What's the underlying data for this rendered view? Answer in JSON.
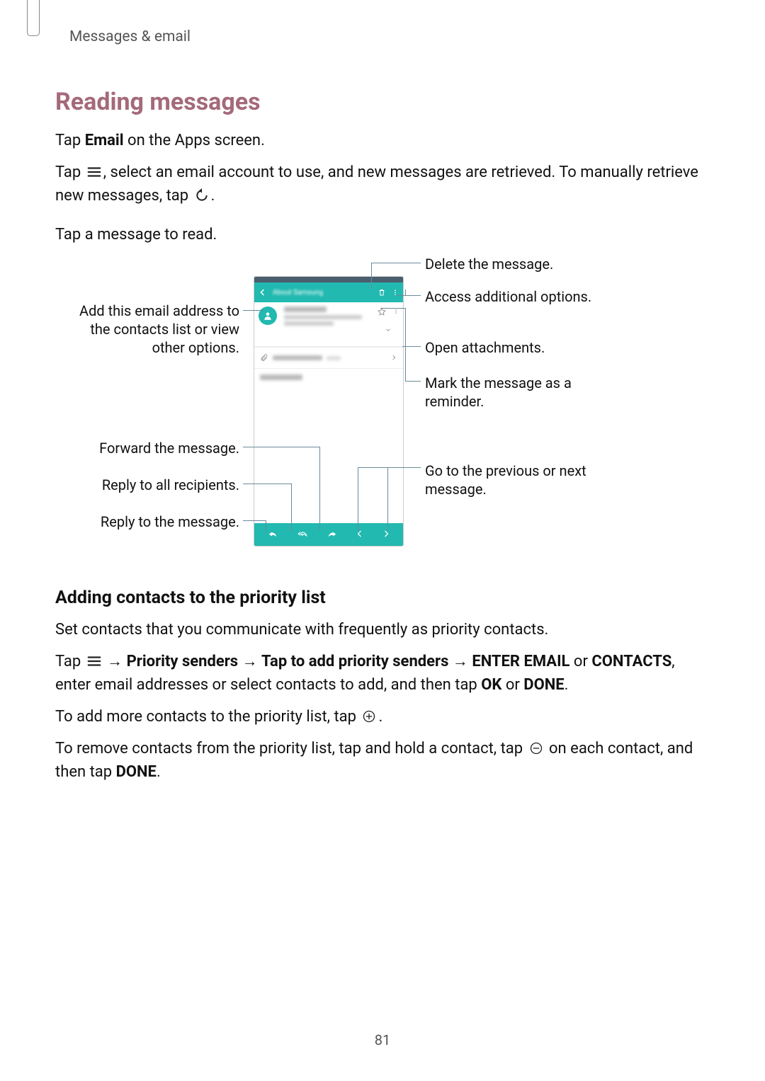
{
  "breadcrumb": "Messages & email",
  "heading1": "Reading messages",
  "para1_a": "Tap ",
  "para1_bold": "Email",
  "para1_b": " on the Apps screen.",
  "para2_a": "Tap ",
  "para2_b": ", select an email account to use, and new messages are retrieved. To manually retrieve new messages, tap ",
  "para2_c": ".",
  "para3": "Tap a message to read.",
  "callouts": {
    "delete": "Delete the message.",
    "options": "Access additional options.",
    "attachments": "Open attachments.",
    "reminder": "Mark the message as a reminder.",
    "navigate": "Go to the previous or next message.",
    "add_contact": "Add this email address to the contacts list or view other options.",
    "forward": "Forward the message.",
    "reply_all": "Reply to all recipients.",
    "reply": "Reply to the message."
  },
  "sub_heading": "Adding contacts to the priority list",
  "sub_p1": "Set contacts that you communicate with frequently as priority contacts.",
  "sub_p2_a": "Tap ",
  "sub_p2_b": " → ",
  "sub_p2_bold1": "Priority senders",
  "sub_p2_c": " → ",
  "sub_p2_bold2": "Tap to add priority senders",
  "sub_p2_d": " → ",
  "sub_p2_bold3": "ENTER EMAIL",
  "sub_p2_e": " or ",
  "sub_p2_bold4": "CONTACTS",
  "sub_p2_f": ", enter email addresses or select contacts to add, and then tap ",
  "sub_p2_bold5": "OK",
  "sub_p2_g": " or ",
  "sub_p2_bold6": "DONE",
  "sub_p2_h": ".",
  "sub_p3_a": "To add more contacts to the priority list, tap ",
  "sub_p3_b": ".",
  "sub_p4_a": "To remove contacts from the priority list, tap and hold a contact, tap ",
  "sub_p4_b": " on each contact, and then tap ",
  "sub_p4_bold": "DONE",
  "sub_p4_c": ".",
  "page_number": "81"
}
